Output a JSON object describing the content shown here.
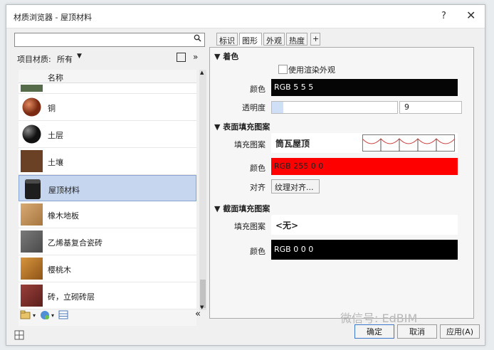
{
  "window": {
    "title": "材质浏览器 - 屋顶材料",
    "help_label": "?",
    "close_label": "✕"
  },
  "left_panel": {
    "search": {
      "placeholder": ""
    },
    "filter": {
      "label": "项目材质:",
      "value": "所有",
      "chevron": "▼",
      "expand": "»"
    },
    "list_header": "名称",
    "materials": [
      {
        "name": "",
        "swatch": "#556b4a",
        "partial": true
      },
      {
        "name": "铜",
        "swatch": "#a0482c"
      },
      {
        "name": "土层",
        "swatch": "#2b2b2b"
      },
      {
        "name": "土壤",
        "swatch": "#6a4125"
      },
      {
        "name": "屋顶材料",
        "swatch": "#2a2a2a",
        "selected": true
      },
      {
        "name": "橡木地板",
        "swatch": "#c39564"
      },
      {
        "name": "乙烯基复合瓷砖",
        "swatch": "#5f5f5f"
      },
      {
        "name": "樱桃木",
        "swatch": "#b5742d"
      },
      {
        "name": "砖，立砌砖层",
        "swatch": "#7a2f2c"
      }
    ],
    "collapse_label": "«"
  },
  "right_panel": {
    "tabs": [
      "标识",
      "图形",
      "外观",
      "热度",
      "+"
    ],
    "active_tab": "图形",
    "shading": {
      "title": "▼ 着色",
      "use_render": "使用渲染外观",
      "color_label": "颜色",
      "color_value": "RGB 5 5 5",
      "color_hex": "#050505",
      "transparency_label": "透明度",
      "transparency": 9
    },
    "surface": {
      "title": "▼ 表面填充图案",
      "pattern_label": "填充图案",
      "pattern_name": "筒瓦屋顶",
      "color_label": "颜色",
      "color_value": "RGB 255 0 0",
      "color_hex": "#ff0000",
      "align_label": "对齐",
      "align_button": "纹理对齐..."
    },
    "cut": {
      "title": "▼ 截面填充图案",
      "pattern_label": "填充图案",
      "pattern_name": "<无>",
      "color_label": "颜色",
      "color_value": "RGB 0 0 0",
      "color_hex": "#000000"
    }
  },
  "footer": {
    "ok": "确定",
    "cancel": "取消",
    "apply": "应用(A)",
    "watermark": "微信号: EdBIM_"
  }
}
